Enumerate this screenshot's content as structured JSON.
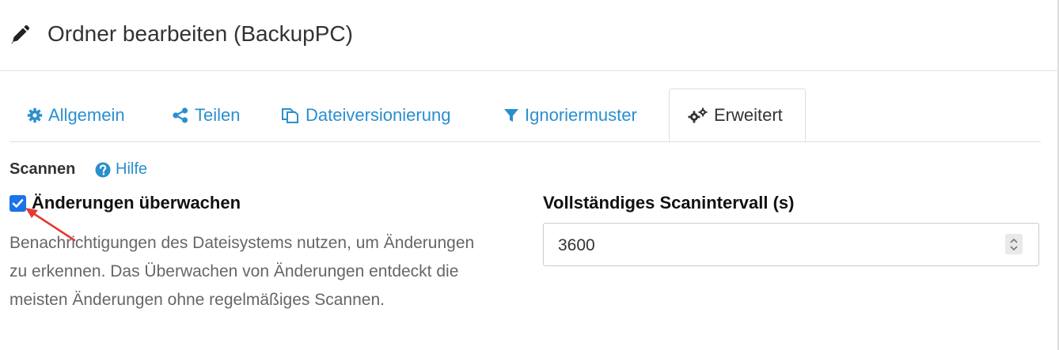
{
  "header": {
    "title": "Ordner bearbeiten (BackupPC)",
    "icon": "pencil-icon"
  },
  "tabs": [
    {
      "label": "Allgemein",
      "icon": "gear-icon",
      "active": false
    },
    {
      "label": "Teilen",
      "icon": "share-icon",
      "active": false
    },
    {
      "label": "Dateiversionierung",
      "icon": "copy-icon",
      "active": false
    },
    {
      "label": "Ignoriermuster",
      "icon": "filter-icon",
      "active": false
    },
    {
      "label": "Erweitert",
      "icon": "gears-icon",
      "active": true
    }
  ],
  "scan": {
    "section_label": "Scannen",
    "help_label": "Hilfe",
    "watch_label": "Änderungen überwachen",
    "watch_checked": true,
    "description": "Benachrichtigungen des Dateisystems nutzen, um Änderungen zu erkennen. Das Überwachen von Änderungen entdeckt die meisten Änderungen ohne regelmäßiges Scannen."
  },
  "rescan": {
    "label": "Vollständiges Scanintervall (s)",
    "value": "3600"
  },
  "colors": {
    "link": "#2a8fce",
    "checkbox": "#1a73e8",
    "annotation_arrow": "#e53935"
  }
}
